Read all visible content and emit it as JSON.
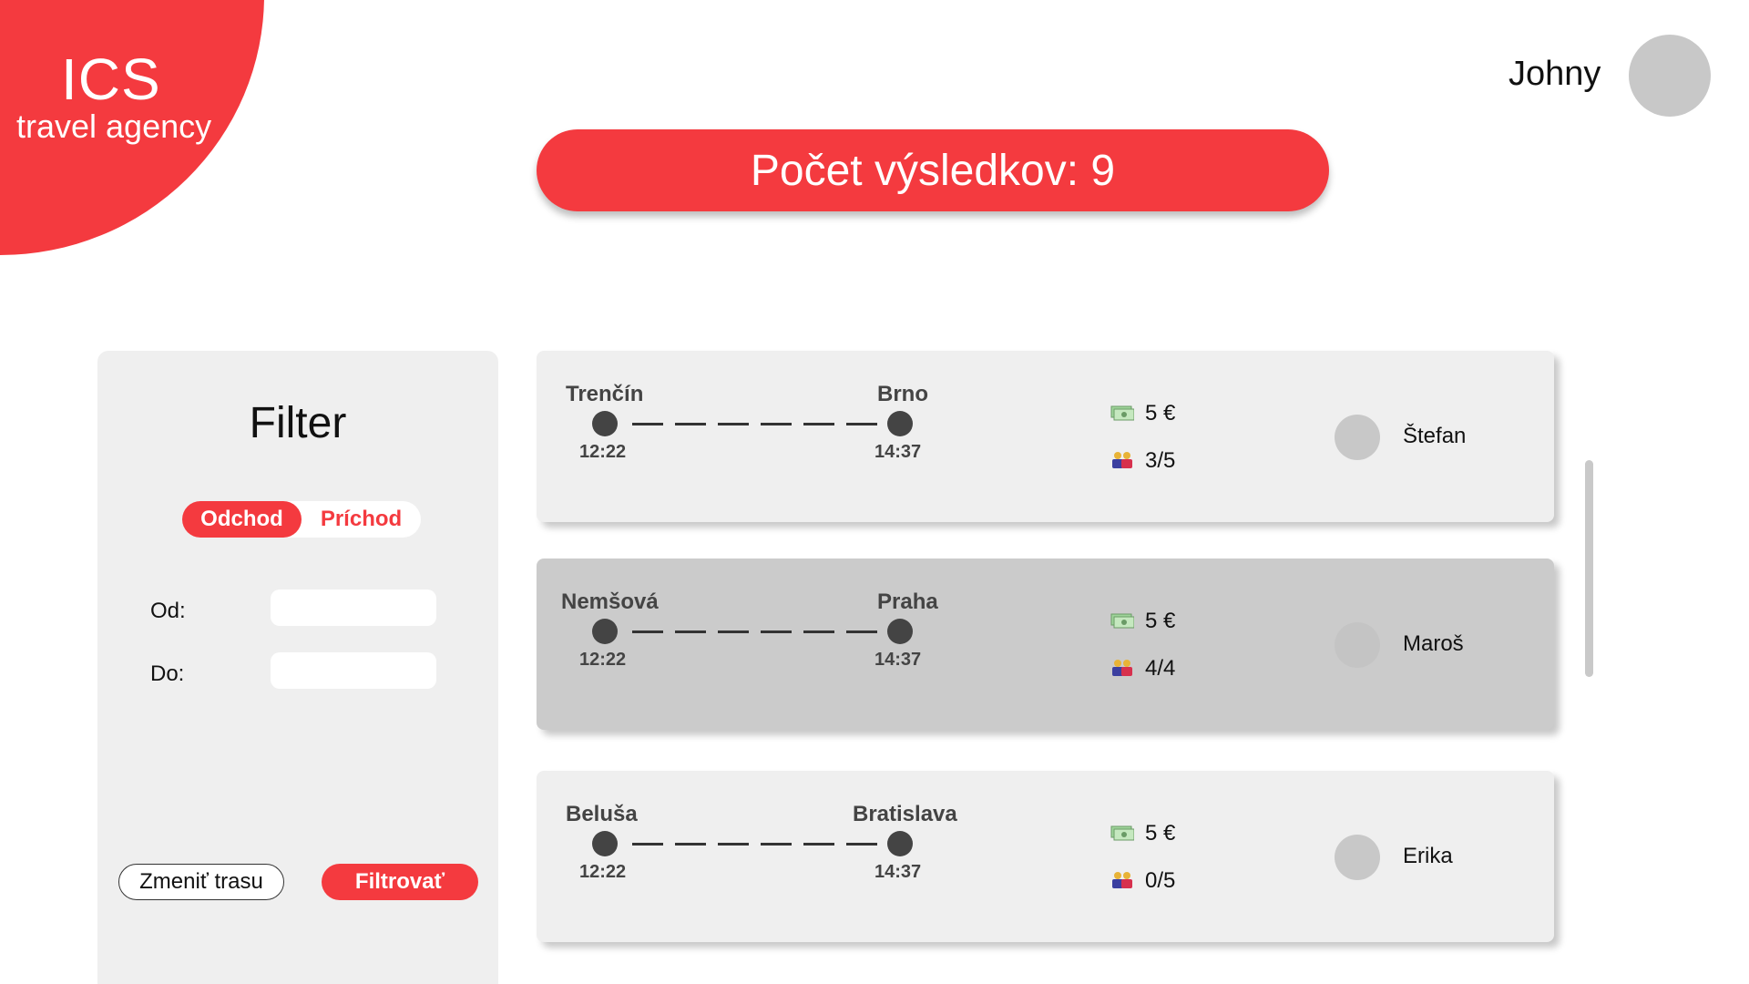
{
  "logo": {
    "title": "ICS",
    "subtitle": "travel agency"
  },
  "user": {
    "name": "Johny"
  },
  "results": {
    "label": "Počet výsledkov: 9"
  },
  "filter": {
    "title": "Filter",
    "toggle": {
      "departure": "Odchod",
      "arrival": "Príchod",
      "active": "departure"
    },
    "from_label": "Od:",
    "to_label": "Do:",
    "from_value": "",
    "to_value": "",
    "change_route_label": "Zmeniť trasu",
    "filter_button_label": "Filtrovať"
  },
  "trips": [
    {
      "from": "Trenčín",
      "to": "Brno",
      "depart": "12:22",
      "arrive": "14:37",
      "price": "5 €",
      "seats": "3/5",
      "driver": "Štefan",
      "selected": false
    },
    {
      "from": "Nemšová",
      "to": "Praha",
      "depart": "12:22",
      "arrive": "14:37",
      "price": "5 €",
      "seats": "4/4",
      "driver": "Maroš",
      "selected": true
    },
    {
      "from": "Beluša",
      "to": "Bratislava",
      "depart": "12:22",
      "arrive": "14:37",
      "price": "5 €",
      "seats": "0/5",
      "driver": "Erika",
      "selected": false
    }
  ],
  "icons": {
    "price": "money-icon",
    "seats": "passengers-icon"
  },
  "colors": {
    "accent": "#f43a3f",
    "panel": "#efefef",
    "selected_card": "#cbcbcb"
  }
}
